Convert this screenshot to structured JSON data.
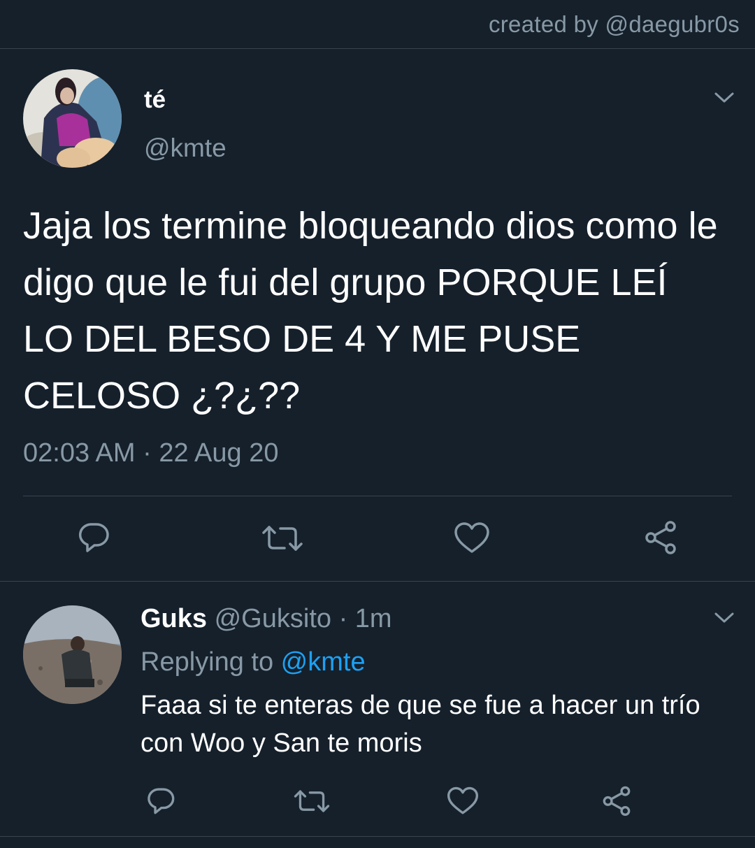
{
  "watermark": "created by @daegubr0s",
  "tweet": {
    "display_name": "té",
    "handle": "@kmte",
    "text": "Jaja los termine bloqueando dios como le digo que le fui del grupo PORQUE LEÍ LO DEL BESO DE 4 Y ME PUSE CELOSO ¿?¿??",
    "timestamp": "02:03 AM · 22 Aug 20",
    "actions": [
      "reply-icon",
      "retweet-icon",
      "like-icon",
      "share-icon"
    ]
  },
  "reply": {
    "display_name": "Guks",
    "meta": " @Guksito · 1m",
    "replying_prefix": "Replying to ",
    "replying_mention": "@kmte",
    "text": "Faaa si te enteras de que se fue a hacer un trío con Woo y San te moris",
    "actions": [
      "reply-icon",
      "retweet-icon",
      "like-icon",
      "share-icon"
    ]
  },
  "colors": {
    "background": "#15202b",
    "secondary_text": "#8899a6",
    "accent": "#1da1f2",
    "divider": "#38444d"
  }
}
